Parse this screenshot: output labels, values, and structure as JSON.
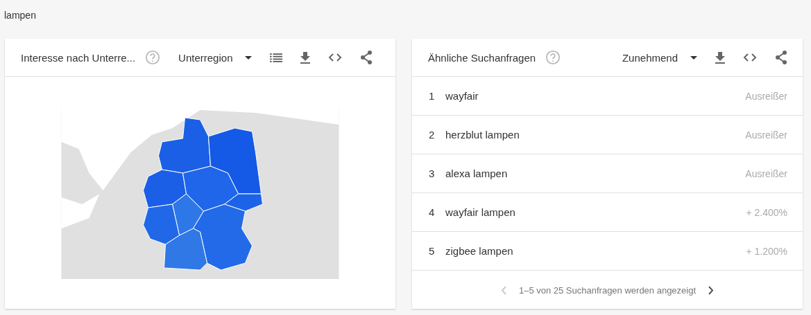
{
  "query": "lampen",
  "region_card": {
    "title": "Interesse nach Unterre...",
    "dropdown": "Unterregion"
  },
  "queries_card": {
    "title": "Ähnliche Suchanfragen",
    "dropdown": "Zunehmend",
    "rows": [
      {
        "rank": "1",
        "term": "wayfair",
        "value": "Ausreißer"
      },
      {
        "rank": "2",
        "term": "herzblut lampen",
        "value": "Ausreißer"
      },
      {
        "rank": "3",
        "term": "alexa lampen",
        "value": "Ausreißer"
      },
      {
        "rank": "4",
        "term": "wayfair lampen",
        "value": "+ 2.400%"
      },
      {
        "rank": "5",
        "term": "zigbee lampen",
        "value": "+ 1.200%"
      }
    ],
    "pagination": {
      "text": "1–5 von 25 Suchanfragen werden angezeigt",
      "prev_disabled": true,
      "next_disabled": false
    }
  }
}
